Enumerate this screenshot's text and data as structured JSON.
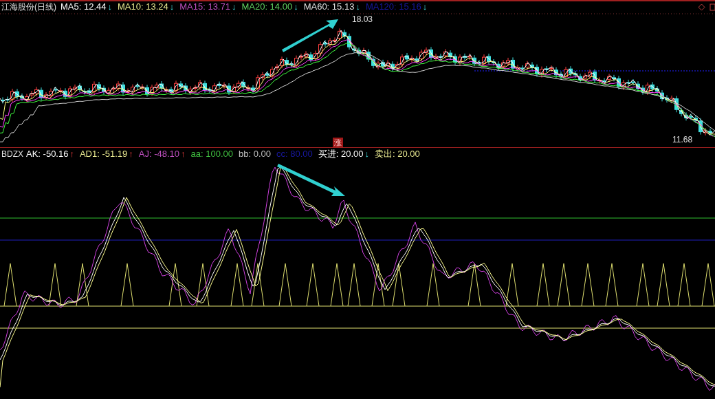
{
  "main_panel": {
    "title": "江海股份(日线)",
    "indicators": [
      {
        "label": "MA5: 12.44",
        "color": "#ffffff",
        "arrow": {
          "symbol": "↓",
          "kind": "down"
        }
      },
      {
        "label": "MA10: 13.24",
        "color": "#e8e890",
        "arrow": {
          "symbol": "↓",
          "kind": "down"
        }
      },
      {
        "label": "MA15: 13.71",
        "color": "#c050c0",
        "arrow": {
          "symbol": "↓",
          "kind": "down"
        }
      },
      {
        "label": "MA20: 14.00",
        "color": "#60d060",
        "arrow": {
          "symbol": "↓",
          "kind": "down"
        }
      },
      {
        "label": "MA60: 15.13",
        "color": "#e0e0e0",
        "arrow": {
          "symbol": "↓",
          "kind": "down"
        }
      },
      {
        "label": "MA120: 15.16",
        "color": "#1818a0",
        "arrow": {
          "symbol": "↓",
          "kind": "down"
        }
      }
    ],
    "high_label": "18.03",
    "low_label": "11.68",
    "marker": "涨"
  },
  "sub_panel": {
    "title": "BDZX",
    "indicators": [
      {
        "label": "AK: -50.16",
        "color": "#ffffff",
        "arrow": {
          "symbol": "↑",
          "kind": "up"
        }
      },
      {
        "label": "AD1: -51.19",
        "color": "#e8e890",
        "arrow": {
          "symbol": "↑",
          "kind": "up"
        }
      },
      {
        "label": "AJ: -48.10",
        "color": "#c050c0",
        "arrow": {
          "symbol": "↑",
          "kind": "up"
        }
      },
      {
        "label": "aa: 100.00",
        "color": "#40c040"
      },
      {
        "label": "bb: 0.00",
        "color": "#c0c0c0"
      },
      {
        "label": "cc: 80.00",
        "color": "#1818a0"
      },
      {
        "label": "买进: 20.00",
        "color": "#ffffff",
        "arrow": {
          "symbol": "↓",
          "kind": "down"
        }
      },
      {
        "label": "卖出: 20.00",
        "color": "#e8e890"
      }
    ]
  }
}
